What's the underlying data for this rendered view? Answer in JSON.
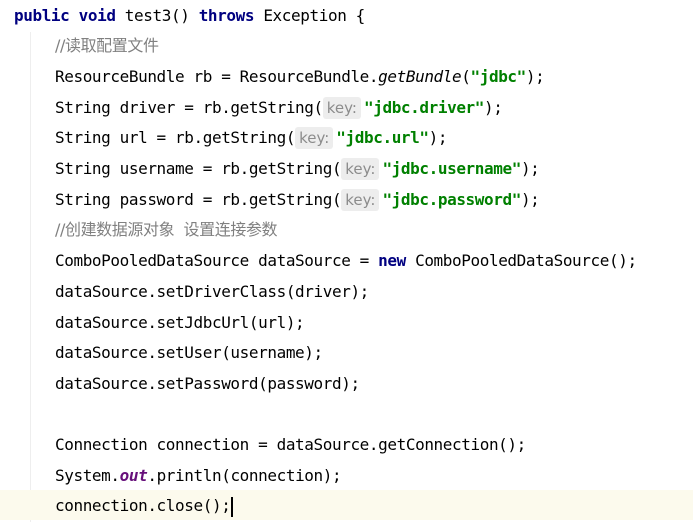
{
  "code": {
    "l1": {
      "kw1": "public",
      "kw2": "void",
      "method": " test3() ",
      "kw3": "throws",
      "rest": " Exception {"
    },
    "l2": {
      "comment": "//读取配置文件"
    },
    "l3": {
      "pre": "ResourceBundle rb = ResourceBundle.",
      "method": "getBundle",
      "open": "(",
      "str": "\"jdbc\"",
      "close": ");"
    },
    "l4": {
      "pre": "String driver = rb.getString(",
      "hint": "key:",
      "str": "\"jdbc.driver\"",
      "close": ");"
    },
    "l5": {
      "pre": "String url = rb.getString(",
      "hint": "key:",
      "str": "\"jdbc.url\"",
      "close": ");"
    },
    "l6": {
      "pre": "String username = rb.getString(",
      "hint": "key:",
      "str": "\"jdbc.username\"",
      "close": ");"
    },
    "l7": {
      "pre": "String password = rb.getString(",
      "hint": "key:",
      "str": "\"jdbc.password\"",
      "close": ");"
    },
    "l8": {
      "comment": "//创建数据源对象  设置连接参数"
    },
    "l9": {
      "pre": "ComboPooledDataSource dataSource = ",
      "kw": "new",
      "post": " ComboPooledDataSource();"
    },
    "l10": {
      "text": "dataSource.setDriverClass(driver);"
    },
    "l11": {
      "text": "dataSource.setJdbcUrl(url);"
    },
    "l12": {
      "text": "dataSource.setUser(username);"
    },
    "l13": {
      "text": "dataSource.setPassword(password);"
    },
    "l15": {
      "text": "Connection connection = dataSource.getConnection();"
    },
    "l16": {
      "pre": "System.",
      "field": "out",
      "post": ".println(connection);"
    },
    "l17": {
      "text": "connection.close();"
    }
  },
  "colors": {
    "keyword": "#000080",
    "string": "#008000",
    "comment": "#808080",
    "static_field": "#660e7a",
    "current_line": "#fcfaed",
    "hint_bg": "#ededed"
  }
}
